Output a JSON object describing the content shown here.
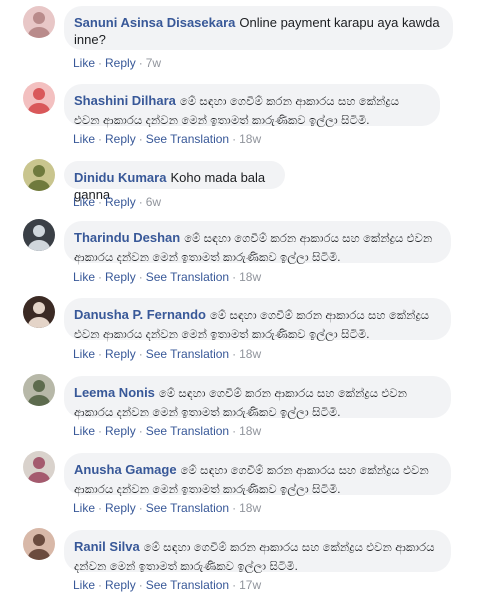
{
  "comments": [
    {
      "author": "Sanuni Asinsa Disasekara",
      "text": "Online payment karapu aya kawda inne?",
      "like": "Like",
      "reply": "Reply",
      "see_translation": "",
      "time": "7w",
      "avatar_colors": [
        "#b98b8b",
        "#e8c7c7"
      ]
    },
    {
      "author": "Shashini Dilhara",
      "text": "මේ සඳහා ගෙවීම් කරන ආකාරය සහ කේන්ද්‍රය එවන ආකාරය දන්වන මෙන් ඉතාමත් කාරුණිකව ඉල්ලා සිටිමි.",
      "like": "Like",
      "reply": "Reply",
      "see_translation": "See Translation",
      "time": "18w",
      "avatar_colors": [
        "#d9585a",
        "#f3c0c0"
      ]
    },
    {
      "author": "Dinidu Kumara",
      "text": "Koho mada bala ganna",
      "like": "Like",
      "reply": "Reply",
      "see_translation": "",
      "time": "6w",
      "avatar_colors": [
        "#6f7a3d",
        "#c9c58e"
      ]
    },
    {
      "author": "Tharindu Deshan",
      "text": "මේ සඳහා ගෙවීම් කරන ආකාරය සහ කේන්ද්‍රය එවන ආකාරය දන්වන මෙන් ඉතාමත් කාරුණිකව ඉල්ලා සිටිමි.",
      "like": "Like",
      "reply": "Reply",
      "see_translation": "See Translation",
      "time": "18w",
      "avatar_colors": [
        "#cfd6dc",
        "#3a3f46"
      ]
    },
    {
      "author": "Danusha P. Fernando",
      "text": "මේ සඳහා ගෙවීම් කරන ආකාරය සහ කේන්ද්‍රය එවන ආකාරය දන්වන මෙන් ඉතාමත් කාරුණිකව ඉල්ලා සිටිමි.",
      "like": "Like",
      "reply": "Reply",
      "see_translation": "See Translation",
      "time": "18w",
      "avatar_colors": [
        "#e4d4c8",
        "#3b2a24"
      ]
    },
    {
      "author": "Leema Nonis",
      "text": "මේ සඳහා ගෙවීම් කරන ආකාරය සහ කේන්ද්‍රය එවන ආකාරය දන්වන මෙන් ඉතාමත් කාරුණිකව ඉල්ලා සිටිමි.",
      "like": "Like",
      "reply": "Reply",
      "see_translation": "See Translation",
      "time": "18w",
      "avatar_colors": [
        "#5d6b4e",
        "#b7b8a8"
      ]
    },
    {
      "author": "Anusha Gamage",
      "text": "මේ සඳහා ගෙවීම් කරන ආකාරය සහ කේන්ද්‍රය එවන ආකාරය දන්වන මෙන් ඉතාමත් කාරුණිකව ඉල්ලා සිටිමි.",
      "like": "Like",
      "reply": "Reply",
      "see_translation": "See Translation",
      "time": "18w",
      "avatar_colors": [
        "#a45a6e",
        "#d9d2cc"
      ]
    },
    {
      "author": "Ranil Silva",
      "text": "මේ සඳහා ගෙවීම් කරන ආකාරය සහ කේන්ද්‍රය එවන ආකාරය දන්වන මෙන් ඉතාමත් කාරුණිකව ඉල්ලා සිටිමි.",
      "like": "Like",
      "reply": "Reply",
      "see_translation": "See Translation",
      "time": "17w",
      "avatar_colors": [
        "#6b4b3e",
        "#d8b8a8"
      ]
    }
  ],
  "colors": {
    "bubble_bg": "#f2f3f5",
    "author": "#385898",
    "meta": "#90949c",
    "text": "#1c1e21"
  }
}
